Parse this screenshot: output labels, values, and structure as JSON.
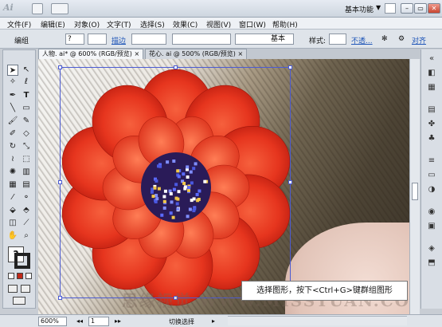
{
  "app": {
    "logo": "Ai",
    "workspace": "基本功能",
    "window_controls": {
      "minimize": "–",
      "restore": "▭",
      "close": "✕"
    }
  },
  "menu": [
    "文件(F)",
    "编辑(E)",
    "对象(O)",
    "文字(T)",
    "选择(S)",
    "效果(C)",
    "视图(V)",
    "窗口(W)",
    "帮助(H)"
  ],
  "control_bar": {
    "selection_type": "编组",
    "fill_value": "?",
    "stroke_label": "描边",
    "stroke_style": "基本",
    "style_label": "样式:",
    "opacity_link": "不透...",
    "align_link": "对齐"
  },
  "tabs": [
    {
      "label": "人物. ai* @ 600% (RGB/预览)",
      "close": "×"
    },
    {
      "label": "花心. ai @ 500% (RGB/预览)",
      "close": "×"
    }
  ],
  "canvas": {
    "caption": "选择图形，按下<Ctrl+G>键群组图形",
    "watermark": "思缘视觉 WWW.MISSYUAN.COM"
  },
  "status_bar": {
    "zoom": "600%",
    "page": "1",
    "tool_name": "切换选择"
  },
  "colors": {
    "petal_outer": "#d42a16",
    "petal_inner": "#f25a3c",
    "center": "#2a1b58",
    "selection": "#4b5bd3"
  },
  "tools": [
    "selection-tool",
    "direct-selection-tool",
    "magic-wand-tool",
    "lasso-tool",
    "pen-tool",
    "type-tool",
    "line-tool",
    "rectangle-tool",
    "paintbrush-tool",
    "pencil-tool",
    "blob-brush-tool",
    "eraser-tool",
    "rotate-tool",
    "scale-tool",
    "warp-tool",
    "free-transform-tool",
    "symbol-sprayer-tool",
    "column-graph-tool",
    "mesh-tool",
    "gradient-tool",
    "eyedropper-tool",
    "blend-tool",
    "live-paint-tool",
    "live-paint-selection-tool",
    "artboard-tool",
    "slice-tool",
    "hand-tool",
    "zoom-tool"
  ]
}
